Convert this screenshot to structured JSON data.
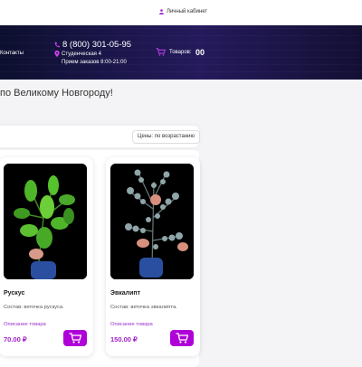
{
  "topbar": {
    "account_label": "Личный кабинет",
    "account_icon": "user-icon"
  },
  "header": {
    "contacts_label": "Контакты",
    "phone": "8 (800) 301-05-95",
    "address": "Студенческая 4",
    "hours": "Прием заказов 8:00-21:00",
    "cart_label": "Товаров:",
    "cart_count": "00"
  },
  "delivery_text": "по Великому Новгороду!",
  "sort": {
    "selected": "Цены: по возрастанию"
  },
  "products": [
    {
      "name": "Рускус",
      "description": "Состав: веточка рускуса.",
      "more_link": "Описание товара",
      "price": "70.00 ₽"
    },
    {
      "name": "Эвкалипт",
      "description": "Состав: веточка эвкалипта.",
      "more_link": "Описание товара",
      "price": "150.00 ₽"
    }
  ],
  "colors": {
    "accent": "#b000d8",
    "price": "#a020c8",
    "header_bg": "#1a1549"
  }
}
